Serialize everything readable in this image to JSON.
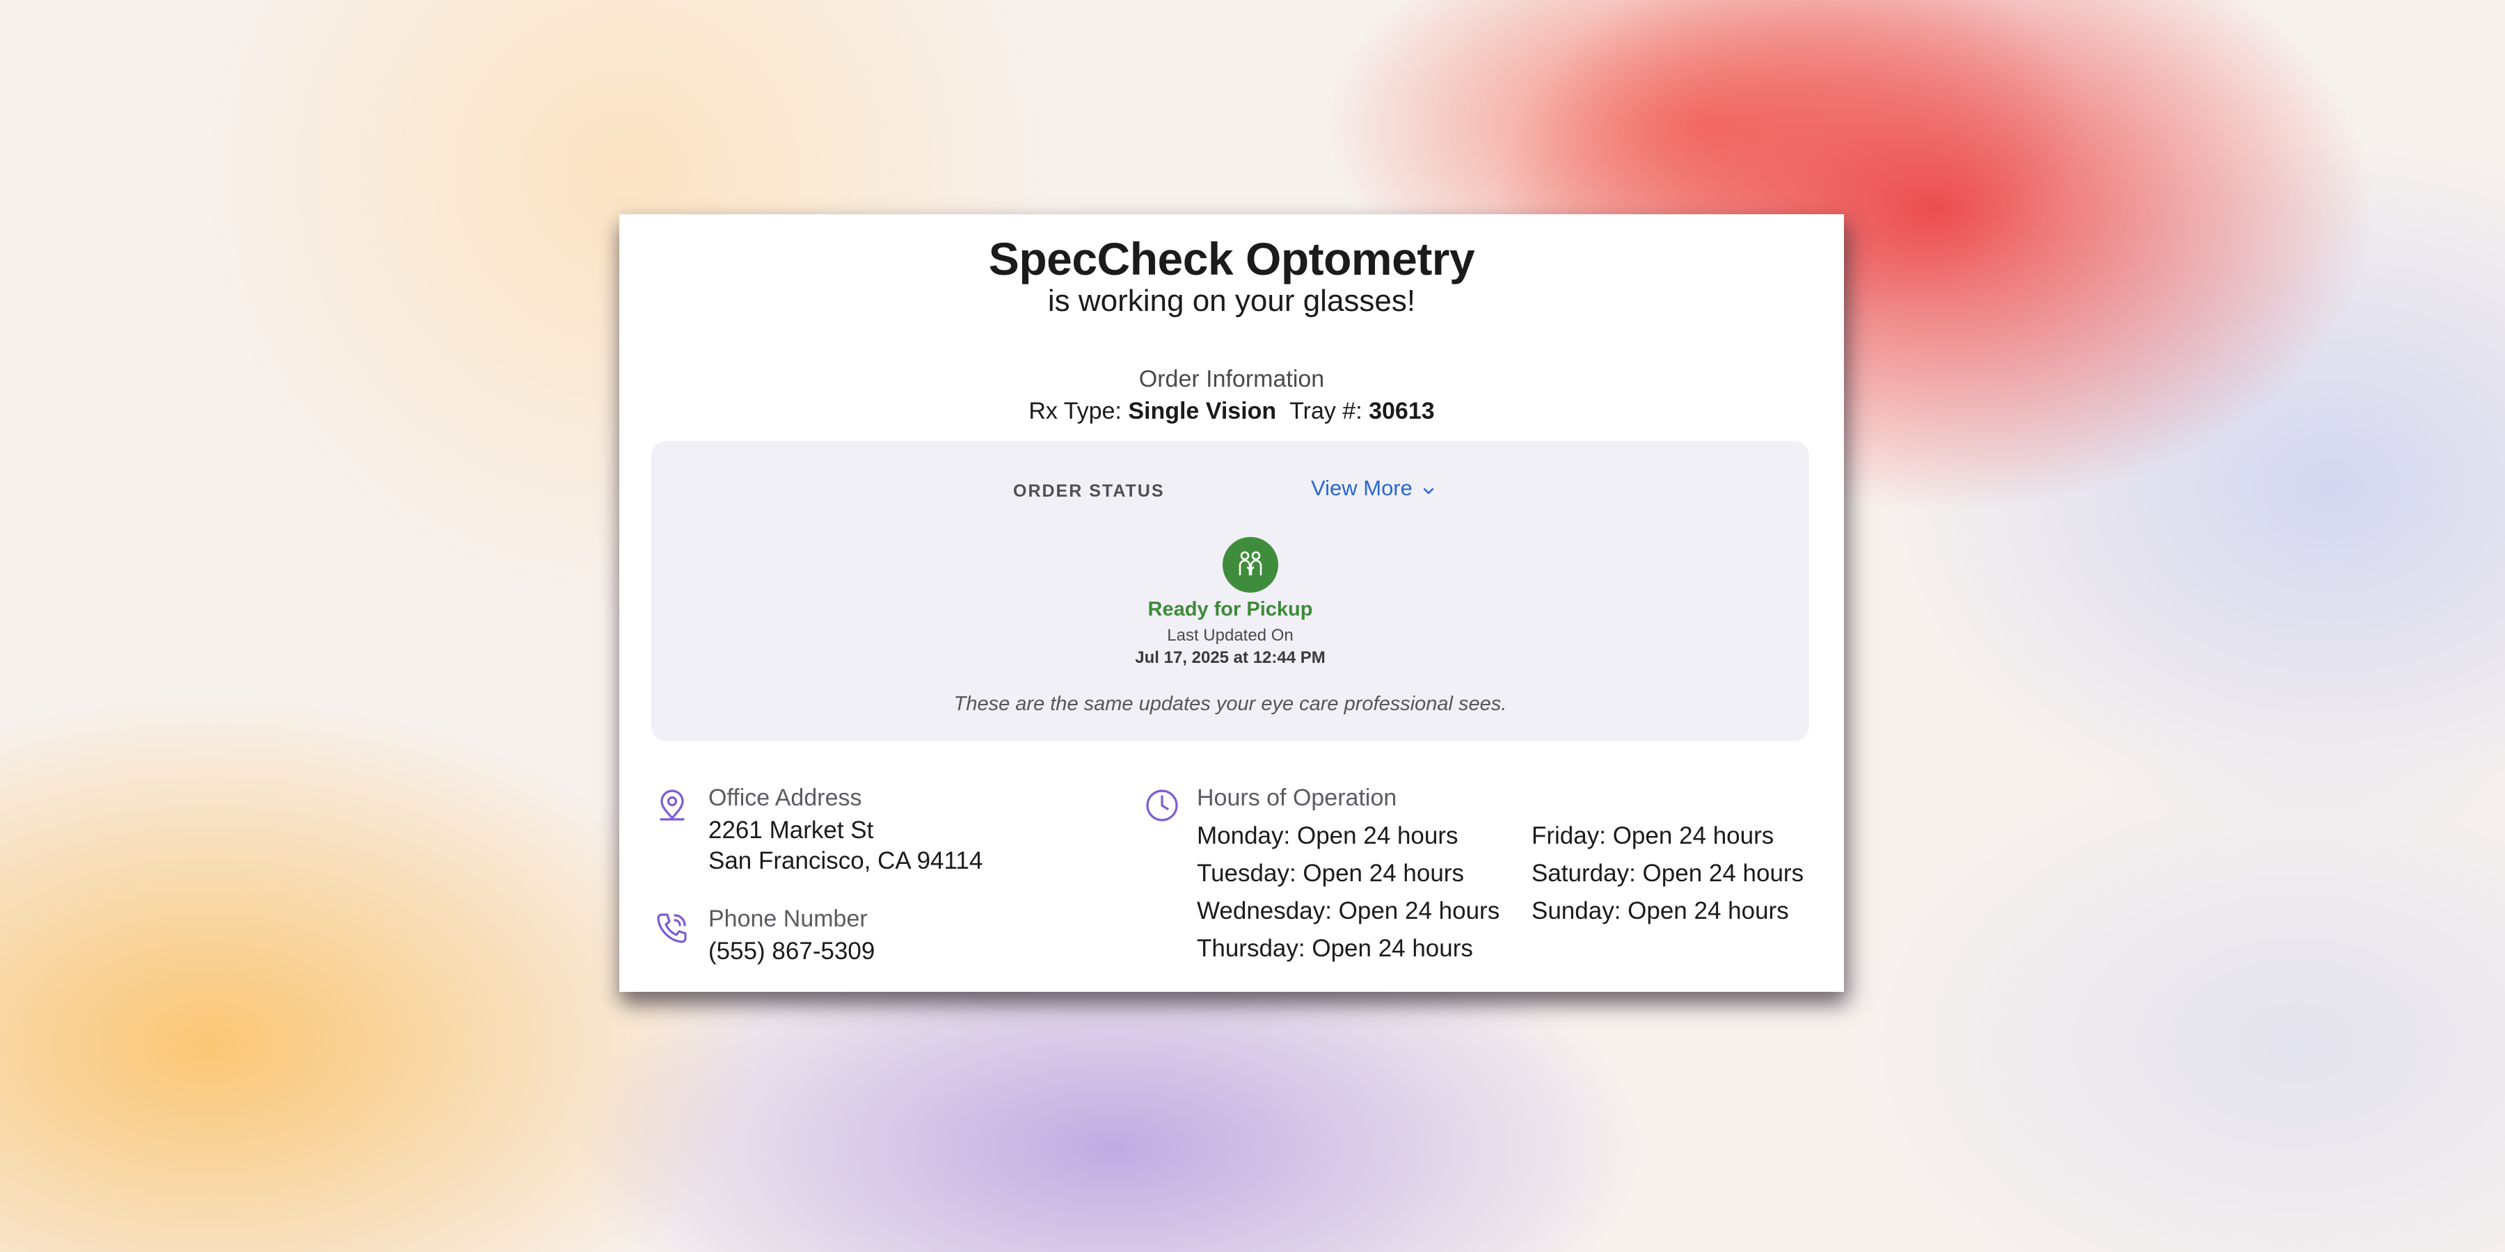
{
  "header": {
    "brand": "SpecCheck Optometry",
    "subtitle": "is working on your glasses!"
  },
  "order_info": {
    "heading": "Order Information",
    "rx_type_label": "Rx Type:",
    "rx_type_value": "Single Vision",
    "tray_label": "Tray #:",
    "tray_value": "30613"
  },
  "order_status": {
    "label": "ORDER STATUS",
    "view_more": "View More",
    "status": "Ready for Pickup",
    "last_updated_label": "Last Updated On",
    "last_updated_value": "Jul 17, 2025 at 12:44 PM",
    "disclaimer": "These are the same updates your eye care professional sees.",
    "status_icon": "people-pickup-icon",
    "status_color": "#3f8d3c"
  },
  "office": {
    "address_label": "Office Address",
    "address_line1": "2261 Market St",
    "address_line2": "San Francisco, CA 94114",
    "phone_label": "Phone Number",
    "phone_value": "(555) 867-5309"
  },
  "hours": {
    "label": "Hours of Operation",
    "days": [
      "Monday: Open 24 hours",
      "Tuesday: Open 24 hours",
      "Wednesday: Open 24 hours",
      "Thursday: Open 24 hours",
      "Friday: Open 24 hours",
      "Saturday: Open 24 hours",
      "Sunday: Open 24 hours"
    ]
  },
  "colors": {
    "accent_icon": "#7b5cd6",
    "link": "#2a67cf",
    "status_panel": "#f1f0f6"
  }
}
